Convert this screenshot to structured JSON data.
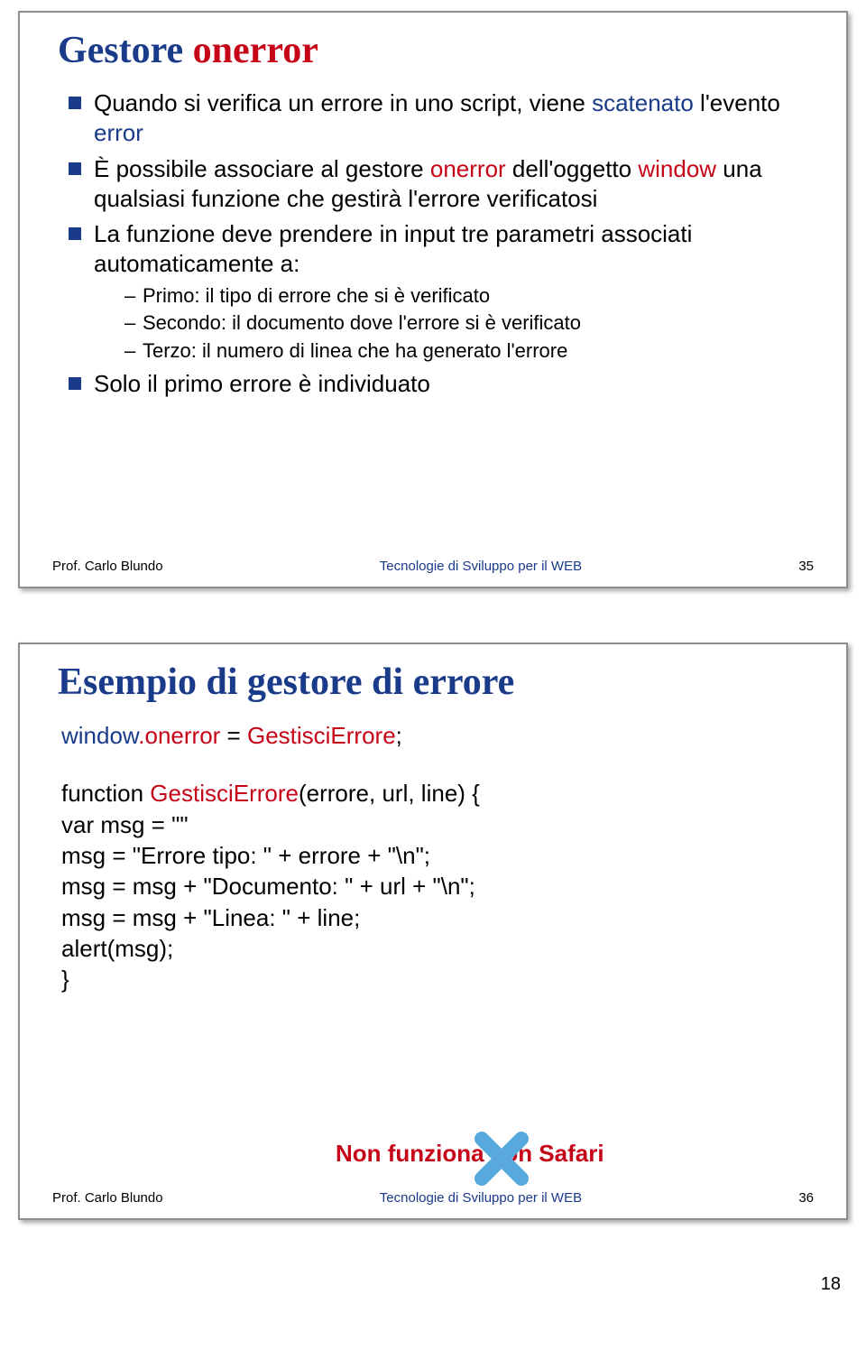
{
  "page_number": "18",
  "slide35": {
    "title_plain": "Gestore ",
    "title_accent": "onerror",
    "bullets": [
      {
        "pre": "Quando si verifica un errore in uno script, viene ",
        "kw1": "scatenato",
        "mid1": " l'evento ",
        "kw2": "error",
        "post": ""
      },
      {
        "pre": "È possibile associare al gestore ",
        "kw1": "onerror",
        "mid1": " dell'oggetto ",
        "kw2": "window",
        "post": " una qualsiasi funzione che gestirà l'errore verificatosi"
      },
      {
        "pre": "La funzione deve prendere in input tre parametri associati automaticamente a:",
        "kw1": "",
        "mid1": "",
        "kw2": "",
        "post": ""
      },
      {
        "pre": "Solo il primo errore è individuato",
        "kw1": "",
        "mid1": "",
        "kw2": "",
        "post": ""
      }
    ],
    "sublist": [
      "Primo: il tipo di errore che si è verificato",
      "Secondo: il documento dove l'errore si è verificato",
      "Terzo: il numero di linea che ha generato l'errore"
    ],
    "footer_left": "Prof. Carlo Blundo",
    "footer_center": "Tecnologie di Sviluppo per il WEB",
    "footer_num": "35"
  },
  "slide36": {
    "title": "Esempio di gestore di errore",
    "line1_a": "window",
    "line1_b": ".onerror",
    "line1_c": " = ",
    "line1_d": "GestisciErrore",
    "line1_e": ";",
    "line2_a": "function ",
    "line2_b": "GestisciErrore",
    "line2_c": "(errore, url, line) {",
    "line3": "var msg = \"\"",
    "line4": "msg = \"Errore tipo: \" + errore + \"\\n\";",
    "line5": "msg = msg + \"Documento: \" + url + \"\\n\";",
    "line6": "msg = msg + \"Linea: \" + line;",
    "line7": "alert(msg);",
    "line8": "}",
    "safari_note": "Non funziona con Safari",
    "footer_left": "Prof. Carlo Blundo",
    "footer_center": "Tecnologie di Sviluppo per il WEB",
    "footer_num": "36"
  }
}
